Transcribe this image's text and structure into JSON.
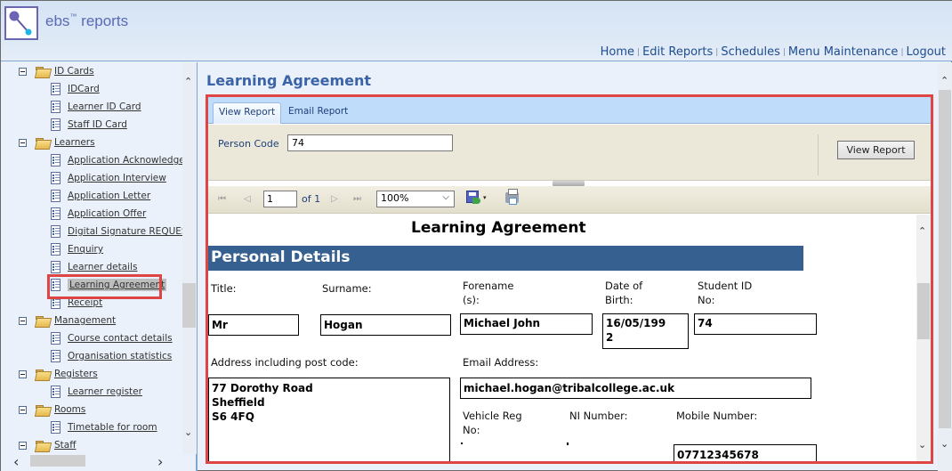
{
  "header": {
    "app_name": "ebs",
    "trademark": "™",
    "app_suffix": "reports",
    "nav": [
      {
        "label": "Home"
      },
      {
        "label": "Edit Reports"
      },
      {
        "label": "Schedules"
      },
      {
        "label": "Menu Maintenance"
      },
      {
        "label": "Logout"
      }
    ],
    "separator": "|"
  },
  "sidebar": {
    "tree": [
      {
        "type": "folder",
        "label": "ID Cards"
      },
      {
        "type": "report",
        "label": "IDCard"
      },
      {
        "type": "report",
        "label": "Learner ID Card"
      },
      {
        "type": "report",
        "label": "Staff ID Card"
      },
      {
        "type": "folder",
        "label": "Learners"
      },
      {
        "type": "report",
        "label": "Application Acknowledgen"
      },
      {
        "type": "report",
        "label": "Application Interview"
      },
      {
        "type": "report",
        "label": "Application Letter"
      },
      {
        "type": "report",
        "label": "Application Offer"
      },
      {
        "type": "report",
        "label": "Digital Signature REQUES"
      },
      {
        "type": "report",
        "label": "Enquiry"
      },
      {
        "type": "report",
        "label": "Learner details"
      },
      {
        "type": "report",
        "label": "Learning Agreement",
        "selected": true
      },
      {
        "type": "report",
        "label": "Receipt"
      },
      {
        "type": "folder",
        "label": "Management"
      },
      {
        "type": "report",
        "label": "Course contact details"
      },
      {
        "type": "report",
        "label": "Organisation statistics"
      },
      {
        "type": "folder",
        "label": "Registers"
      },
      {
        "type": "report",
        "label": "Learner register"
      },
      {
        "type": "folder",
        "label": "Rooms"
      },
      {
        "type": "report",
        "label": "Timetable for room"
      },
      {
        "type": "folder",
        "label": "Staff"
      }
    ]
  },
  "main": {
    "page_title": "Learning Agreement",
    "tabs": [
      {
        "label": "View Report",
        "active": true
      },
      {
        "label": "Email Report",
        "active": false
      }
    ],
    "params": {
      "person_code_label": "Person Code",
      "person_code_value": "74",
      "view_report_button": "View Report"
    },
    "toolbar": {
      "first_icon": "⏮",
      "prev_icon": "◁",
      "page_value": "1",
      "of_label": "of 1",
      "next_icon": "▷",
      "last_icon": "⏭",
      "zoom_value": "100%",
      "zoom_chevron": "⌵",
      "save_dropdown": "▾"
    },
    "report": {
      "title": "Learning Agreement",
      "section": "Personal Details",
      "labels": {
        "title": "Title:",
        "surname": "Surname:",
        "forename": "Forename\n(s):",
        "dob": "Date of\nBirth:",
        "student_id": "Student ID\nNo:",
        "address": "Address including post code:",
        "email": "Email Address:",
        "vehicle": "Vehicle Reg\nNo:",
        "ni": "NI Number:",
        "mobile": "Mobile Number:"
      },
      "values": {
        "title": "Mr",
        "surname": "Hogan",
        "forename": "Michael John",
        "dob": "16/05/199\n2",
        "student_id": "74",
        "address": "77 Dorothy Road\nSheffield\nS6 4FQ",
        "email": "michael.hogan@tribalcollege.ac.uk",
        "mobile": "07712345678"
      }
    }
  },
  "scroll": {
    "up": "⌃",
    "down": "⌄",
    "left": "‹",
    "right": "›"
  }
}
